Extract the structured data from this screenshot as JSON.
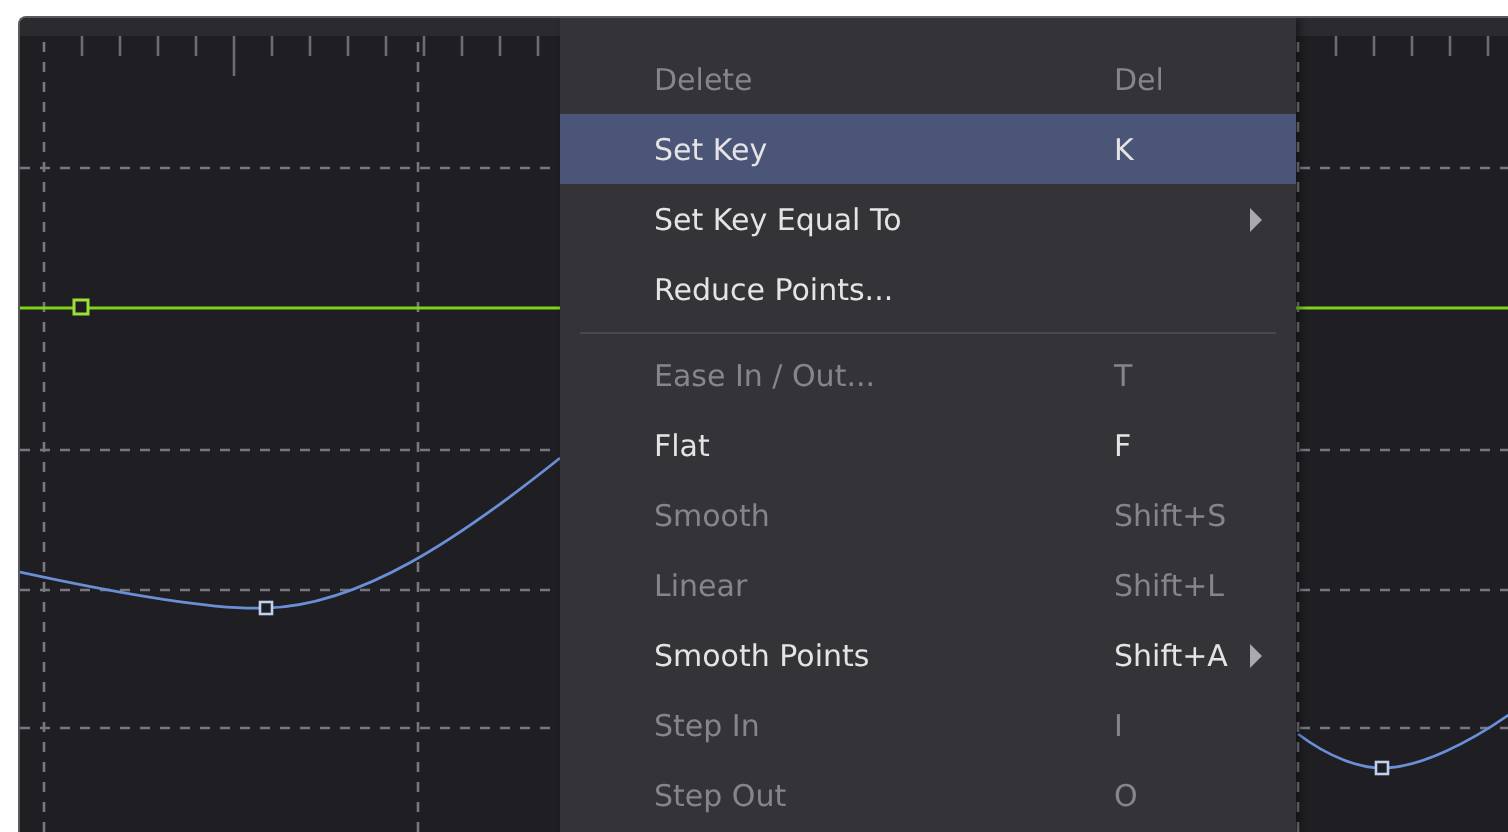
{
  "menu": {
    "items": [
      {
        "kind": "item",
        "label": "Delete",
        "shortcut": "Del",
        "disabled": true,
        "selected": false,
        "submenu": false
      },
      {
        "kind": "item",
        "label": "Set Key",
        "shortcut": "K",
        "disabled": false,
        "selected": true,
        "submenu": false
      },
      {
        "kind": "item",
        "label": "Set Key Equal To",
        "disabled": false,
        "selected": false,
        "submenu": true
      },
      {
        "kind": "item",
        "label": "Reduce Points...",
        "disabled": false,
        "selected": false,
        "submenu": false
      },
      {
        "kind": "separator"
      },
      {
        "kind": "item",
        "label": "Ease In / Out...",
        "shortcut": "T",
        "disabled": true,
        "selected": false,
        "submenu": false
      },
      {
        "kind": "item",
        "label": "Flat",
        "shortcut": "F",
        "disabled": false,
        "selected": false,
        "submenu": false
      },
      {
        "kind": "item",
        "label": "Smooth",
        "shortcut": "Shift+S",
        "disabled": true,
        "selected": false,
        "submenu": false
      },
      {
        "kind": "item",
        "label": "Linear",
        "shortcut": "Shift+L",
        "disabled": true,
        "selected": false,
        "submenu": false
      },
      {
        "kind": "item",
        "label": "Smooth Points",
        "shortcut": "Shift+A",
        "disabled": false,
        "selected": false,
        "submenu": true
      },
      {
        "kind": "item",
        "label": "Step In",
        "shortcut": "I",
        "disabled": true,
        "selected": false,
        "submenu": false
      },
      {
        "kind": "item",
        "label": "Step Out",
        "shortcut": "O",
        "disabled": true,
        "selected": false,
        "submenu": false
      }
    ]
  }
}
